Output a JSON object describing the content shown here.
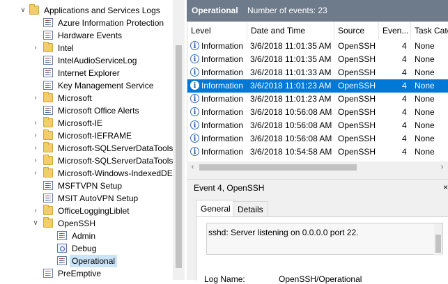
{
  "tree": {
    "items": [
      {
        "label": "Applications and Services Logs",
        "type": "folder",
        "depth": 0,
        "expanded": true
      },
      {
        "label": "Azure Information Protection",
        "type": "log",
        "depth": 1
      },
      {
        "label": "Hardware Events",
        "type": "log",
        "depth": 1
      },
      {
        "label": "Intel",
        "type": "folder",
        "depth": 1,
        "expanded": false
      },
      {
        "label": "IntelAudioServiceLog",
        "type": "log",
        "depth": 1
      },
      {
        "label": "Internet Explorer",
        "type": "log",
        "depth": 1
      },
      {
        "label": "Key Management Service",
        "type": "log",
        "depth": 1
      },
      {
        "label": "Microsoft",
        "type": "folder",
        "depth": 1,
        "expanded": false
      },
      {
        "label": "Microsoft Office Alerts",
        "type": "log",
        "depth": 1
      },
      {
        "label": "Microsoft-IE",
        "type": "folder",
        "depth": 1,
        "expanded": false
      },
      {
        "label": "Microsoft-IEFRAME",
        "type": "folder",
        "depth": 1,
        "expanded": false
      },
      {
        "label": "Microsoft-SQLServerDataTools",
        "type": "folder",
        "depth": 1,
        "expanded": false
      },
      {
        "label": "Microsoft-SQLServerDataTools\\",
        "type": "folder",
        "depth": 1,
        "expanded": false
      },
      {
        "label": "Microsoft-Windows-IndexedDE",
        "type": "folder",
        "depth": 1,
        "expanded": false
      },
      {
        "label": "MSFTVPN Setup",
        "type": "log",
        "depth": 1
      },
      {
        "label": "MSIT AutoVPN Setup",
        "type": "log",
        "depth": 1
      },
      {
        "label": "OfficeLoggingLiblet",
        "type": "folder",
        "depth": 1,
        "expanded": false
      },
      {
        "label": "OpenSSH",
        "type": "folder",
        "depth": 1,
        "expanded": true
      },
      {
        "label": "Admin",
        "type": "log",
        "depth": 2
      },
      {
        "label": "Debug",
        "type": "debug",
        "depth": 2
      },
      {
        "label": "Operational",
        "type": "log",
        "depth": 2,
        "selected": true
      },
      {
        "label": "PreEmptive",
        "type": "log",
        "depth": 1
      }
    ]
  },
  "header": {
    "title": "Operational",
    "count_text": "Number of events: 23"
  },
  "grid": {
    "columns": [
      "Level",
      "Date and Time",
      "Source",
      "Even...",
      "Task Cate"
    ],
    "rows": [
      {
        "level": "Information",
        "datetime": "3/6/2018 11:01:35 AM",
        "source": "OpenSSH",
        "event": "4",
        "task": "None",
        "selected": false
      },
      {
        "level": "Information",
        "datetime": "3/6/2018 11:01:35 AM",
        "source": "OpenSSH",
        "event": "4",
        "task": "None",
        "selected": false
      },
      {
        "level": "Information",
        "datetime": "3/6/2018 11:01:33 AM",
        "source": "OpenSSH",
        "event": "4",
        "task": "None",
        "selected": false
      },
      {
        "level": "Information",
        "datetime": "3/6/2018 11:01:23 AM",
        "source": "OpenSSH",
        "event": "4",
        "task": "None",
        "selected": true
      },
      {
        "level": "Information",
        "datetime": "3/6/2018 11:01:23 AM",
        "source": "OpenSSH",
        "event": "4",
        "task": "None",
        "selected": false
      },
      {
        "level": "Information",
        "datetime": "3/6/2018 10:56:08 AM",
        "source": "OpenSSH",
        "event": "4",
        "task": "None",
        "selected": false
      },
      {
        "level": "Information",
        "datetime": "3/6/2018 10:56:08 AM",
        "source": "OpenSSH",
        "event": "4",
        "task": "None",
        "selected": false
      },
      {
        "level": "Information",
        "datetime": "3/6/2018 10:56:08 AM",
        "source": "OpenSSH",
        "event": "4",
        "task": "None",
        "selected": false
      },
      {
        "level": "Information",
        "datetime": "3/6/2018 10:54:58 AM",
        "source": "OpenSSH",
        "event": "4",
        "task": "None",
        "selected": false
      }
    ]
  },
  "event_pane": {
    "title": "Event 4, OpenSSH",
    "close_glyph": "×",
    "tabs": [
      "General",
      "Details"
    ],
    "message": "sshd: Server listening on 0.0.0.0 port 22.",
    "log_name_label": "Log Name:",
    "log_name_value": "OpenSSH/Operational"
  },
  "colors": {
    "header_bg": "#6e7b8b",
    "selection": "#0078d7",
    "tree_selection": "#cce4f7"
  },
  "icons": {
    "tree_collapsed": "chevron-right-icon",
    "tree_expanded": "chevron-down-icon",
    "level": "info-icon"
  }
}
